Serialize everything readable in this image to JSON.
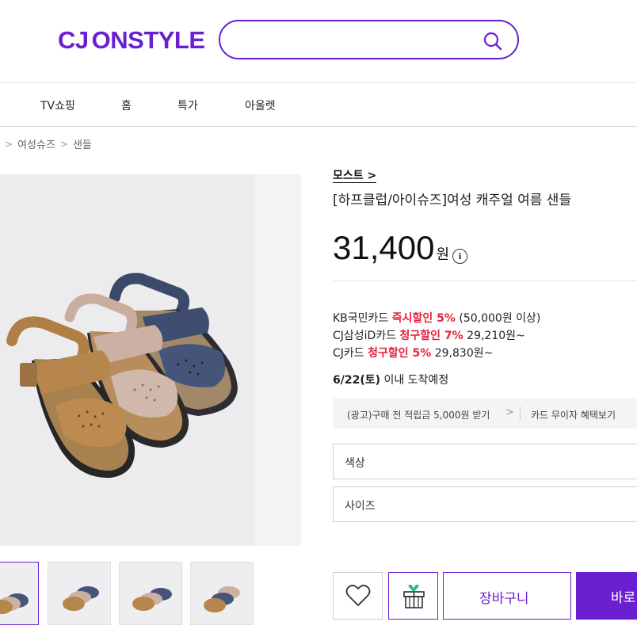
{
  "header": {
    "logo": "CJ ONSTYLE",
    "logo_cj": "CJ",
    "logo_onstyle": "ONSTYLE",
    "search_value": "",
    "search_icon": "search-icon",
    "accent_color": "#6a1fd1"
  },
  "nav": {
    "items": [
      {
        "label": "TV쇼핑"
      },
      {
        "label": "홈"
      },
      {
        "label": "특가"
      },
      {
        "label": "아울렛"
      }
    ]
  },
  "breadcrumb": {
    "items": [
      "여성슈즈",
      "샌들"
    ]
  },
  "product": {
    "brand": "모스트",
    "title": "[하프클럽/아이슈즈]여성 캐주얼 여름 샌들",
    "price": "31,400",
    "price_unit": "원",
    "info_icon": "info-icon"
  },
  "card_discounts": [
    {
      "card": "KB국민카드 ",
      "label": "즉시할인 5%",
      "detail": " (50,000원 이상)"
    },
    {
      "card": "CJ삼성iD카드 ",
      "label": "청구할인 7%",
      "detail": " 29,210원~"
    },
    {
      "card": "CJ카드 ",
      "label": "청구할인 5%",
      "detail": " 29,830원~"
    }
  ],
  "delivery": {
    "date": "6/22(토)",
    "text": " 이내 도착예정"
  },
  "ad_bar": {
    "left": "(광고)구매 전 적립금 5,000원 받기",
    "right": "카드 무이자 혜택보기"
  },
  "options": {
    "color": "색상",
    "size": "사이즈"
  },
  "actions": {
    "wish_icon": "heart-icon",
    "gift_icon": "gift-icon",
    "cart_label": "장바구니",
    "buy_label": "바로"
  }
}
